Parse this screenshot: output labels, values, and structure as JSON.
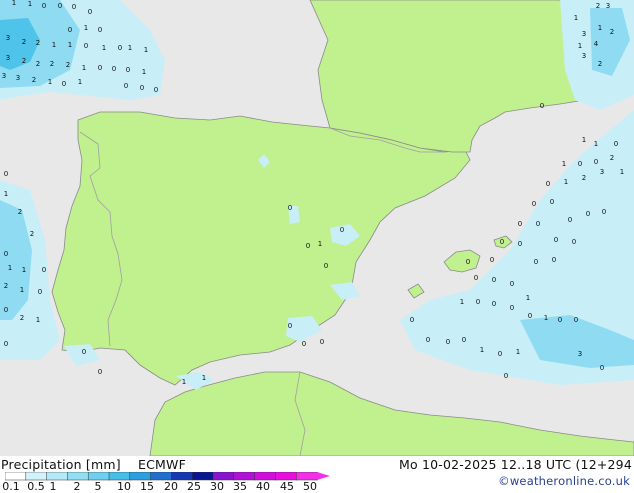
{
  "map": {
    "colors": {
      "sea": "#e8e8e8",
      "land": "#c1f08f",
      "border": "#a0a0a0",
      "coast": "#8a8a8a",
      "precip_light": "#c8eef8",
      "precip_mid": "#8fdcf2",
      "precip_heavy": "#4ec4ea"
    },
    "amount_labels": [
      "1",
      "1",
      "0",
      "0",
      "0",
      "0",
      "3",
      "2",
      "2",
      "1",
      "1",
      "0",
      "1",
      "0",
      "0",
      "1",
      "0",
      "3",
      "2",
      "2",
      "2",
      "2",
      "1",
      "0",
      "0",
      "1",
      "1",
      "0",
      "1",
      "3",
      "3",
      "2",
      "1",
      "0",
      "1",
      "0",
      "0",
      "0",
      "0",
      "1",
      "2",
      "2",
      "0",
      "1",
      "1",
      "0",
      "2",
      "1",
      "0",
      "0",
      "2",
      "1",
      "0",
      "0",
      "0",
      "0",
      "0",
      "1",
      "0",
      "0",
      "0",
      "0",
      "0",
      "1",
      "1",
      "0",
      "1",
      "1",
      "0",
      "1",
      "0",
      "0",
      "2",
      "3",
      "2",
      "1",
      "2",
      "3",
      "1",
      "4",
      "1",
      "3",
      "2",
      "0",
      "1",
      "2",
      "3",
      "1",
      "0",
      "0",
      "0",
      "0",
      "0",
      "0",
      "0",
      "0",
      "0",
      "0",
      "0",
      "0",
      "0",
      "0",
      "0",
      "0",
      "0",
      "0",
      "1",
      "1",
      "0",
      "0",
      "0",
      "0",
      "1",
      "0",
      "0",
      "0",
      "0",
      "0",
      "0",
      "1",
      "0",
      "1",
      "3",
      "0",
      "0"
    ]
  },
  "legend": {
    "title": "Precipitation [mm]",
    "model": "ECMWF",
    "ticks": [
      "0.1",
      "0.5",
      "1",
      "2",
      "5",
      "10",
      "15",
      "20",
      "25",
      "30",
      "35",
      "40",
      "45",
      "50"
    ],
    "colors": [
      "#ffffff",
      "#d2f3fb",
      "#b4eaf8",
      "#92def4",
      "#6dd0f0",
      "#45beea",
      "#2b9fe0",
      "#1f6fd0",
      "#1537b4",
      "#0a1592",
      "#8a12d0",
      "#b210d8",
      "#d00ede",
      "#e80ee0",
      "#f230ea"
    ],
    "arrow_color": "#f230ea"
  },
  "valid_time": "Mo 10-02-2025 12..18 UTC (12+294",
  "credit": "©weatheronline.co.uk"
}
